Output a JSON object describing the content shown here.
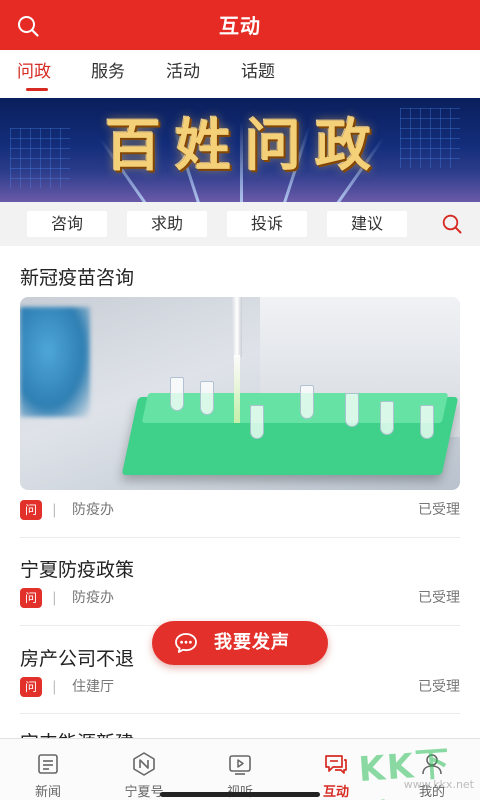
{
  "header": {
    "title": "互动",
    "search_icon": "search-icon"
  },
  "tabs": [
    {
      "label": "问政",
      "active": true
    },
    {
      "label": "服务",
      "active": false
    },
    {
      "label": "活动",
      "active": false
    },
    {
      "label": "话题",
      "active": false
    }
  ],
  "banner": {
    "title": "百姓问政"
  },
  "categories": {
    "items": [
      "咨询",
      "求助",
      "投诉",
      "建议"
    ],
    "search_icon": "search-icon"
  },
  "questions": [
    {
      "title": "新冠疫苗咨询",
      "badge": "问",
      "separator": "|",
      "department": "防疫办",
      "status": "已受理",
      "has_image": true
    },
    {
      "title": "宁夏防疫政策",
      "badge": "问",
      "separator": "|",
      "department": "防疫办",
      "status": "已受理"
    },
    {
      "title": "房产公司不退",
      "badge": "问",
      "separator": "|",
      "department": "住建厅",
      "status": "已受理"
    },
    {
      "title": "宝丰能源新建"
    }
  ],
  "fab": {
    "label": "我要发声",
    "icon": "chat-bubble-icon"
  },
  "bottom_nav": [
    {
      "label": "新闻",
      "icon": "news-icon",
      "active": false
    },
    {
      "label": "宁夏号",
      "icon": "ningxia-hao-icon",
      "active": false
    },
    {
      "label": "视听",
      "icon": "video-icon",
      "active": false
    },
    {
      "label": "互动",
      "icon": "interaction-icon",
      "active": true
    },
    {
      "label": "我的",
      "icon": "profile-icon",
      "active": false
    }
  ],
  "watermark": {
    "text": "KK下载",
    "url": "www.kkx.net"
  },
  "colors": {
    "brand": "#e62b24",
    "accent_text": "#d62a22",
    "background": "#ffffff",
    "category_bar": "#f2f2f2"
  }
}
